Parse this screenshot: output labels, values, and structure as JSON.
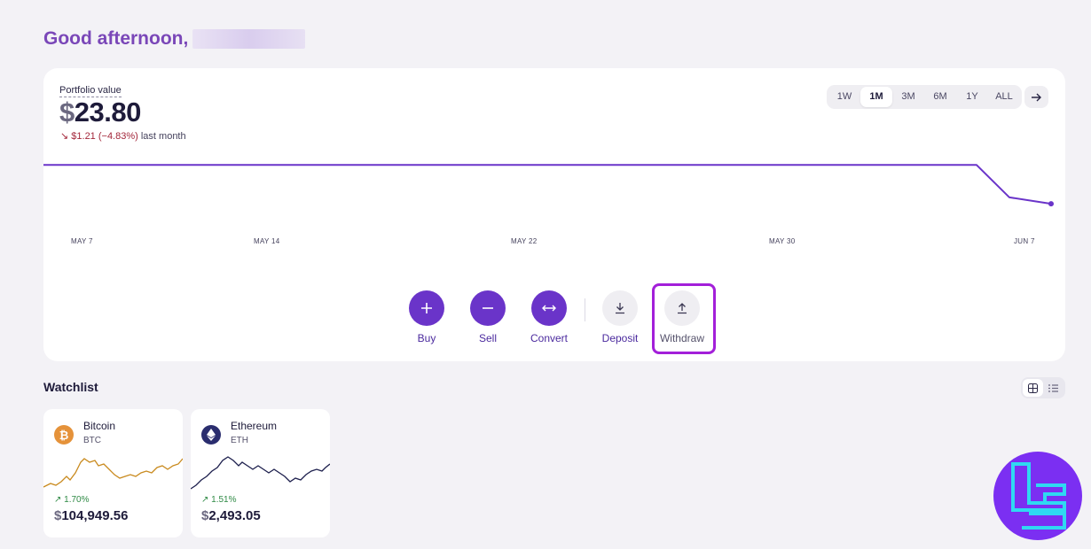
{
  "header": {
    "greeting": "Good afternoon,"
  },
  "portfolio": {
    "label": "Portfolio value",
    "currency": "$",
    "value": "23.80",
    "change": "↘ $1.21 (−4.83%)",
    "change_period": "last month",
    "ranges": [
      "1W",
      "1M",
      "3M",
      "6M",
      "1Y",
      "ALL"
    ],
    "active_range": "1M",
    "x_labels": [
      "MAY 7",
      "MAY 14",
      "MAY 22",
      "MAY 30",
      "JUN 7"
    ]
  },
  "chart_data": {
    "type": "line",
    "title": "",
    "xlabel": "",
    "ylabel": "",
    "grid": false,
    "x": [
      "MAY 7",
      "MAY 14",
      "MAY 22",
      "MAY 30",
      "JUN 5",
      "JUN 6",
      "JUN 7"
    ],
    "series": [
      {
        "values": [
          25.01,
          25.01,
          25.01,
          25.01,
          25.01,
          24.0,
          23.8
        ]
      }
    ]
  },
  "actions": {
    "buy": "Buy",
    "sell": "Sell",
    "convert": "Convert",
    "deposit": "Deposit",
    "withdraw": "Withdraw"
  },
  "watchlist": {
    "title": "Watchlist",
    "items": [
      {
        "name": "Bitcoin",
        "symbol": "BTC",
        "change": "↗ 1.70%",
        "currency": "$",
        "price": "104,949.56",
        "color": "#c98a1e",
        "icon": "bitcoin-icon"
      },
      {
        "name": "Ethereum",
        "symbol": "ETH",
        "change": "↗ 1.51%",
        "currency": "$",
        "price": "2,493.05",
        "color": "#1d1f4d",
        "icon": "ethereum-icon"
      }
    ]
  },
  "colors": {
    "accent": "#6a34c9",
    "negative": "#a3263a",
    "positive": "#2f8a45",
    "highlight": "#a31fd9"
  }
}
